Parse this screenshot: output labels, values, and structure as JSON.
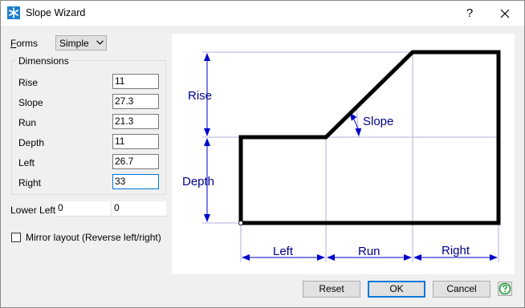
{
  "window": {
    "title": "Slope Wizard",
    "help_label": "?",
    "accent_color": "#0078d7",
    "diagram_label_color": "#00008b"
  },
  "form": {
    "forms_label": "Forms",
    "forms_value": "Simple",
    "dimensions_title": "Dimensions",
    "fields": {
      "rise": {
        "label": "Rise",
        "value": "11"
      },
      "slope": {
        "label": "Slope",
        "value": "27.3"
      },
      "run": {
        "label": "Run",
        "value": "21.3"
      },
      "depth": {
        "label": "Depth",
        "value": "11"
      },
      "left": {
        "label": "Left",
        "value": "26.7"
      },
      "right": {
        "label": "Right",
        "value": "33"
      }
    },
    "lower_left_label": "Lower Left",
    "lower_left_x": "0",
    "lower_left_y": "0",
    "mirror_label": "Mirror layout (Reverse left/right)",
    "mirror_checked": false
  },
  "diagram": {
    "rise_label": "Rise",
    "slope_label": "Slope",
    "depth_label": "Depth",
    "left_label": "Left",
    "run_label": "Run",
    "right_label": "Right"
  },
  "buttons": {
    "reset": "Reset",
    "ok": "OK",
    "cancel": "Cancel"
  },
  "icons": [
    "app-snowflake-icon",
    "close-icon",
    "chevron-down-icon",
    "help-circle-icon"
  ]
}
